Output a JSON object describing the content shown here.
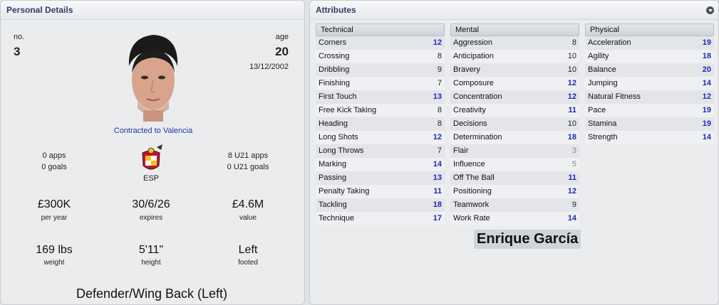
{
  "personal": {
    "title": "Personal Details",
    "number_label": "no.",
    "number": "3",
    "age_label": "age",
    "age": "20",
    "dob": "13/12/2002",
    "contract": "Contracted to Valencia",
    "apps": "0 apps",
    "goals": "0 goals",
    "nation": "ESP",
    "u21_apps": "8 U21 apps",
    "u21_goals": "0 U21 goals",
    "wage": "£300K",
    "wage_label": "per year",
    "expires": "30/6/26",
    "expires_label": "expires",
    "value": "£4.6M",
    "value_label": "value",
    "weight": "169 lbs",
    "weight_label": "weight",
    "height": "5'11\"",
    "height_label": "height",
    "foot": "Left",
    "foot_label": "footed",
    "position": "Defender/Wing Back (Left)"
  },
  "attributes": {
    "title": "Attributes",
    "player_name": "Enrique García",
    "columns": [
      {
        "header": "Technical",
        "rows": [
          {
            "name": "Corners",
            "value": "12"
          },
          {
            "name": "Crossing",
            "value": "8"
          },
          {
            "name": "Dribbling",
            "value": "9"
          },
          {
            "name": "Finishing",
            "value": "7"
          },
          {
            "name": "First Touch",
            "value": "13"
          },
          {
            "name": "Free Kick Taking",
            "value": "8"
          },
          {
            "name": "Heading",
            "value": "8"
          },
          {
            "name": "Long Shots",
            "value": "12"
          },
          {
            "name": "Long Throws",
            "value": "7"
          },
          {
            "name": "Marking",
            "value": "14"
          },
          {
            "name": "Passing",
            "value": "13"
          },
          {
            "name": "Penalty Taking",
            "value": "11"
          },
          {
            "name": "Tackling",
            "value": "18"
          },
          {
            "name": "Technique",
            "value": "17"
          }
        ]
      },
      {
        "header": "Mental",
        "rows": [
          {
            "name": "Aggression",
            "value": "8"
          },
          {
            "name": "Anticipation",
            "value": "10"
          },
          {
            "name": "Bravery",
            "value": "10"
          },
          {
            "name": "Composure",
            "value": "12"
          },
          {
            "name": "Concentration",
            "value": "12"
          },
          {
            "name": "Creativity",
            "value": "11"
          },
          {
            "name": "Decisions",
            "value": "10"
          },
          {
            "name": "Determination",
            "value": "18"
          },
          {
            "name": "Flair",
            "value": "3"
          },
          {
            "name": "Influence",
            "value": "5"
          },
          {
            "name": "Off The Ball",
            "value": "11"
          },
          {
            "name": "Positioning",
            "value": "12"
          },
          {
            "name": "Teamwork",
            "value": "9"
          },
          {
            "name": "Work Rate",
            "value": "14"
          }
        ]
      },
      {
        "header": "Physical",
        "rows": [
          {
            "name": "Acceleration",
            "value": "19"
          },
          {
            "name": "Agility",
            "value": "18"
          },
          {
            "name": "Balance",
            "value": "20"
          },
          {
            "name": "Jumping",
            "value": "14"
          },
          {
            "name": "Natural Fitness",
            "value": "12"
          },
          {
            "name": "Pace",
            "value": "19"
          },
          {
            "name": "Stamina",
            "value": "19"
          },
          {
            "name": "Strength",
            "value": "14"
          }
        ]
      }
    ]
  },
  "colors": {
    "high_value": "#1b2bb5",
    "header_text": "#2b3f66",
    "contract_link": "#1a3a9a"
  },
  "icons": [
    "avatar",
    "spain-crest-icon",
    "menu-dropdown-icon"
  ]
}
